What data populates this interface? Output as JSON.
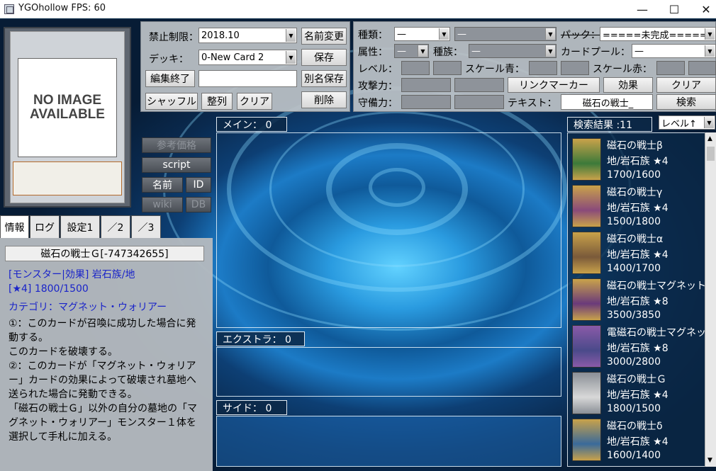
{
  "window": {
    "title": "YGOhollow FPS: 60",
    "minimize": "—",
    "maximize": "☐",
    "close": "✕"
  },
  "card_preview": {
    "placeholder_text": "NO IMAGE AVAILABLE"
  },
  "deck_panel": {
    "banlist_label": "禁止制限：",
    "banlist_value": "2018.10",
    "rename_button": "名前変更",
    "deck_label": "デッキ：",
    "deck_value": "0-New Card 2",
    "save_button": "保存",
    "end_edit_button": "編集終了",
    "deck_name_input": "",
    "save_as_button": "別名保存",
    "shuffle_button": "シャッフル",
    "sort_button": "整列",
    "clear_button": "クリア",
    "delete_button": "削除"
  },
  "filter_panel": {
    "type_label": "種類：",
    "type_value": "—",
    "subtype_value": "—",
    "pack_label": "パック：",
    "pack_value": "=====未完成=======",
    "attribute_label": "属性：",
    "attribute_value": "—",
    "race_label": "種族：",
    "race_value": "—",
    "card_pool_label": "カードプール：",
    "card_pool_value": "—",
    "level_label": "レベル：",
    "scale_blue_label": "スケール青：",
    "scale_red_label": "スケール赤：",
    "attack_label": "攻撃力：",
    "link_marker_button": "リンクマーカー",
    "effect_button": "効果",
    "clear_button": "クリア",
    "defense_label": "守備力：",
    "text_label": "テキスト：",
    "text_value": "磁石の戦士_",
    "search_button": "検索"
  },
  "side_buttons": {
    "reference_price": "参考価格",
    "script": "script",
    "name": "名前",
    "id": "ID",
    "wiki": "wiki",
    "db": "DB"
  },
  "tabs": [
    "情報",
    "ログ",
    "設定1",
    "／2",
    "／3"
  ],
  "info": {
    "card_name": "磁石の戦士Ｇ[-747342655]",
    "type_line": "[モンスター|効果] 岩石族/地",
    "stats_line": "[★4] 1800/1500",
    "category_line": "カテゴリ：マグネット・ウォリアー",
    "effect_lines": [
      "①：このカードが召喚に成功した場合に発",
      "動する。",
      "このカードを破壊する。",
      "②：このカードが「マグネット・ウォリア",
      "ー」カードの効果によって破壊され墓地へ",
      "送られた場合に発動できる。",
      "「磁石の戦士Ｇ」以外の自分の墓地の「マ",
      "グネット・ウォリアー」モンスター１体を",
      "選択して手札に加える。"
    ]
  },
  "deck_sections": {
    "main": "メイン： 0",
    "extra": "エクストラ： 0",
    "side": "サイド： 0"
  },
  "search": {
    "result_header": "検索結果 :11",
    "sort_value": "レベル↑",
    "results": [
      {
        "name": "磁石の戦士β",
        "attr_line": "地/岩石族 ★4",
        "stats": "1700/1600",
        "art_color": "#3c7a3a"
      },
      {
        "name": "磁石の戦士γ",
        "attr_line": "地/岩石族 ★4",
        "stats": "1500/1800",
        "art_color": "#8a4a7a"
      },
      {
        "name": "磁石の戦士α",
        "attr_line": "地/岩石族 ★4",
        "stats": "1400/1700",
        "art_color": "#7a5a3a"
      },
      {
        "name": "磁石の戦士マグネット・",
        "attr_line": "地/岩石族 ★8",
        "stats": "3500/3850",
        "art_color": "#6a3a7a"
      },
      {
        "name": "電磁石の戦士マグネット",
        "attr_line": "地/岩石族 ★8",
        "stats": "3000/2800",
        "art_color": "#4a4a8a"
      },
      {
        "name": "磁石の戦士Ｇ",
        "attr_line": "地/岩石族 ★4",
        "stats": "1800/1500",
        "art_color": "#d8d8d8"
      },
      {
        "name": "磁石の戦士δ",
        "attr_line": "地/岩石族 ★4",
        "stats": "1600/1400",
        "art_color": "#3a6a9a"
      }
    ]
  }
}
